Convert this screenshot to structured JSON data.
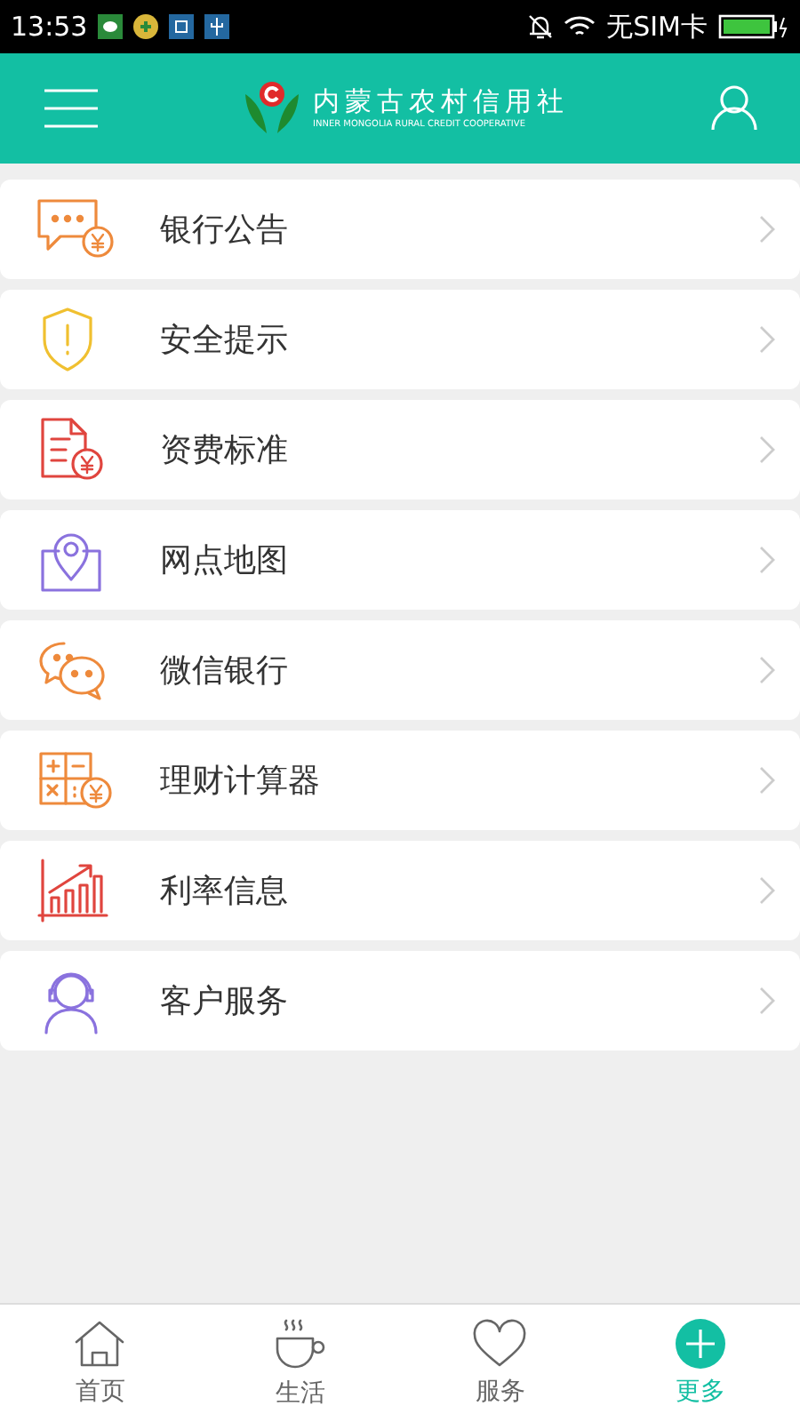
{
  "status_bar": {
    "time": "13:53",
    "carrier": "无SIM卡"
  },
  "header": {
    "logo_title": "内蒙古农村信用社",
    "logo_subtitle": "INNER MONGOLIA RURAL CREDIT COOPERATIVE"
  },
  "menu": [
    {
      "label": "银行公告"
    },
    {
      "label": "安全提示"
    },
    {
      "label": "资费标准"
    },
    {
      "label": "网点地图"
    },
    {
      "label": "微信银行"
    },
    {
      "label": "理财计算器"
    },
    {
      "label": "利率信息"
    },
    {
      "label": "客户服务"
    }
  ],
  "tabs": [
    {
      "label": "首页",
      "selected": false
    },
    {
      "label": "生活",
      "selected": false
    },
    {
      "label": "服务",
      "selected": false
    },
    {
      "label": "更多",
      "selected": true
    }
  ]
}
